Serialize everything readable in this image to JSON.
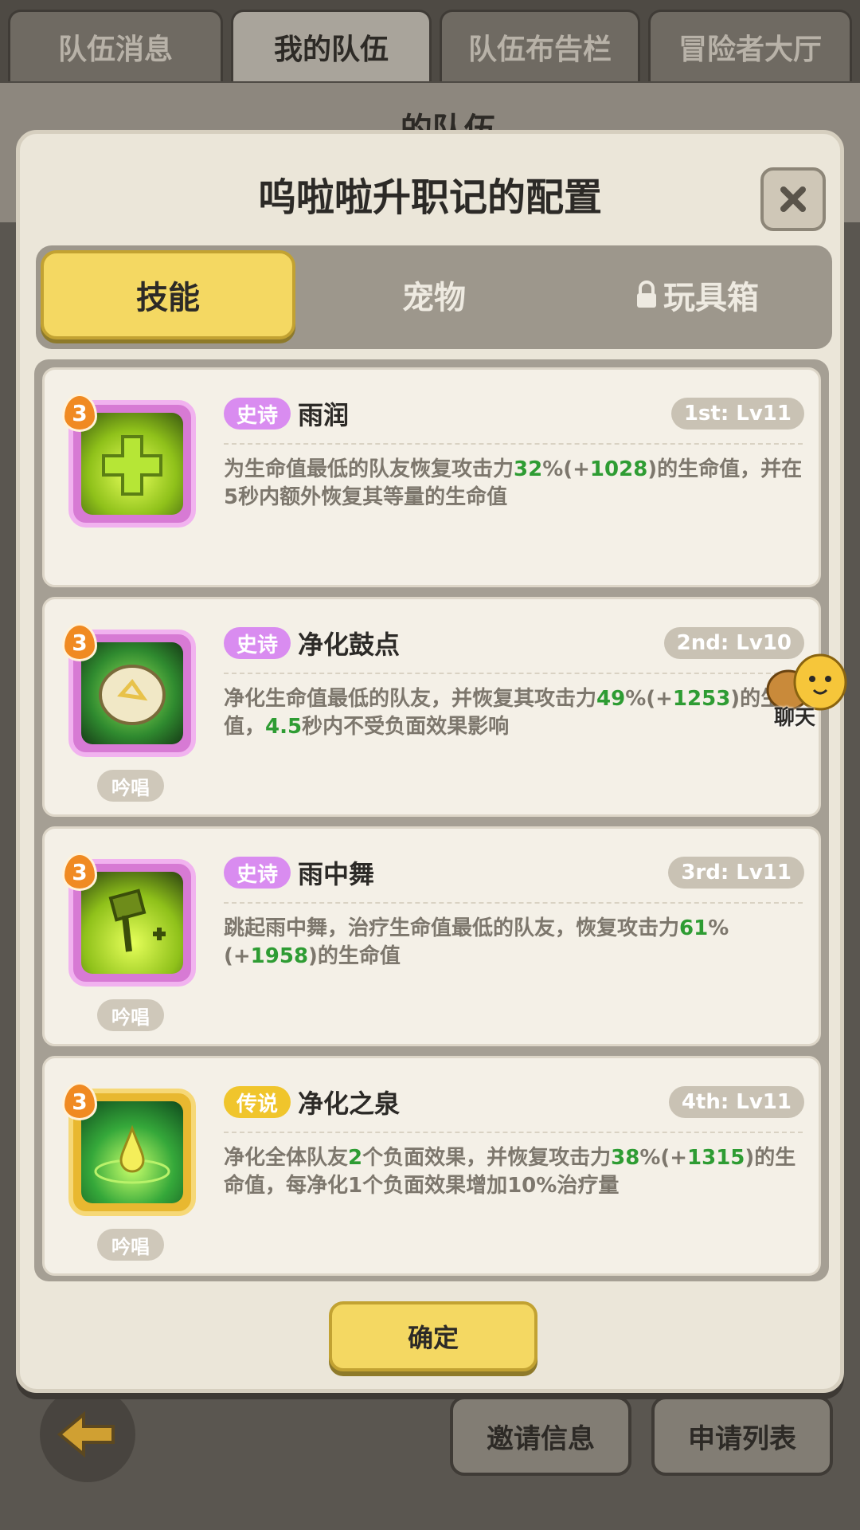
{
  "top_tabs": [
    "队伍消息",
    "我的队伍",
    "队伍布告栏",
    "冒险者大厅"
  ],
  "bg_title": "...的队伍",
  "bottom_buttons": {
    "invite": "邀请信息",
    "apply": "申请列表"
  },
  "modal": {
    "title": "呜啦啦升职记的配置",
    "close_icon": "close-icon",
    "tabs": [
      {
        "label": "技能",
        "active": true
      },
      {
        "label": "宠物",
        "active": false
      },
      {
        "label": "玩具箱",
        "active": false,
        "locked": true
      }
    ],
    "skills": [
      {
        "level": "3",
        "rarity": "史诗",
        "name": "雨润",
        "slot": "1st: Lv11",
        "chant": "",
        "desc_parts": [
          "为生命值最低的队友恢复攻击力",
          "32",
          "%(+",
          "1028",
          ")的生命值，并在5秒内额外恢复其等量的生命值"
        ]
      },
      {
        "level": "3",
        "rarity": "史诗",
        "name": "净化鼓点",
        "slot": "2nd: Lv10",
        "chant": "吟唱",
        "desc_parts": [
          "净化生命值最低的队友，并恢复其攻击力",
          "49",
          "%(+",
          "1253",
          ")的生命值，",
          "4.5",
          "秒内不受负面效果影响"
        ]
      },
      {
        "level": "3",
        "rarity": "史诗",
        "name": "雨中舞",
        "slot": "3rd: Lv11",
        "chant": "吟唱",
        "desc_parts": [
          "跳起雨中舞，治疗生命值最低的队友，恢复攻击力",
          "61",
          "%(+",
          "1958",
          ")的生命值"
        ]
      },
      {
        "level": "3",
        "rarity": "传说",
        "name": "净化之泉",
        "slot": "4th: Lv11",
        "chant": "吟唱",
        "desc_parts": [
          "净化全体队友",
          "2",
          "个负面效果，并恢复攻击力",
          "38",
          "%(+",
          "1315",
          ")的生命值，每净化1个负面效果增加10%治疗量"
        ]
      }
    ],
    "confirm_label": "确定"
  },
  "chat": {
    "label": "聊天"
  },
  "colors": {
    "accent_yellow": "#f4d862",
    "epic": "#d98cf0",
    "legend": "#f0c52c",
    "highlight_green": "#2e9c33"
  }
}
